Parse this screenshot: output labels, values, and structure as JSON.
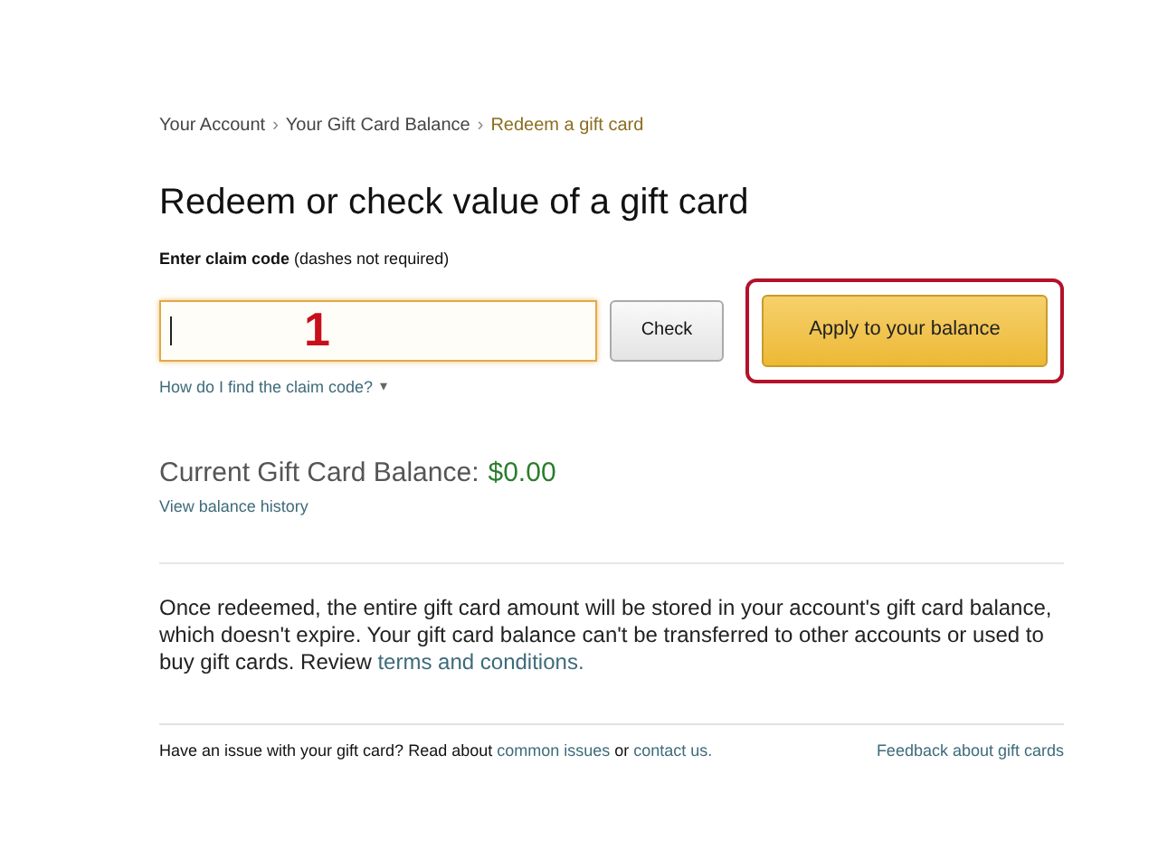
{
  "breadcrumb": [
    {
      "label": "Your Account",
      "selected": false
    },
    {
      "label": "Your Gift Card Balance",
      "selected": false
    },
    {
      "label": "Redeem a gift card",
      "selected": true
    }
  ],
  "breadcrumb_separator": "›",
  "title": "Redeem or check value of a gift card",
  "claim_field": {
    "label": "**Enter claim code** (dashes not required)",
    "focused": true
  },
  "annotation": {
    "number": "1"
  },
  "check_button": "Check",
  "apply_button": {
    "label": "Apply to your balance",
    "highlighted": true
  },
  "help_link": {
    "label": "How do I find the claim code?",
    "caret": "▾"
  },
  "balance": {
    "label": "Current Gift Card Balance:",
    "amount": "$0.00",
    "history_link": "View balance history"
  },
  "info": [
    {
      "kind": "text",
      "text": "Once redeemed, the entire gift card amount will be stored in your account's gift card balance, which doesn't expire. Your gift card balance can't be transferred to other accounts or used to buy gift cards. Review "
    },
    {
      "kind": "link",
      "text": "terms and conditions."
    }
  ],
  "footer": {
    "segments": [
      {
        "kind": "text",
        "text": "Have an issue with your gift card? Read about "
      },
      {
        "kind": "link",
        "text": "common issues"
      },
      {
        "kind": "text",
        "text": " or "
      },
      {
        "kind": "link",
        "text": "contact us."
      }
    ],
    "feedback_link": "Feedback about gift cards"
  }
}
